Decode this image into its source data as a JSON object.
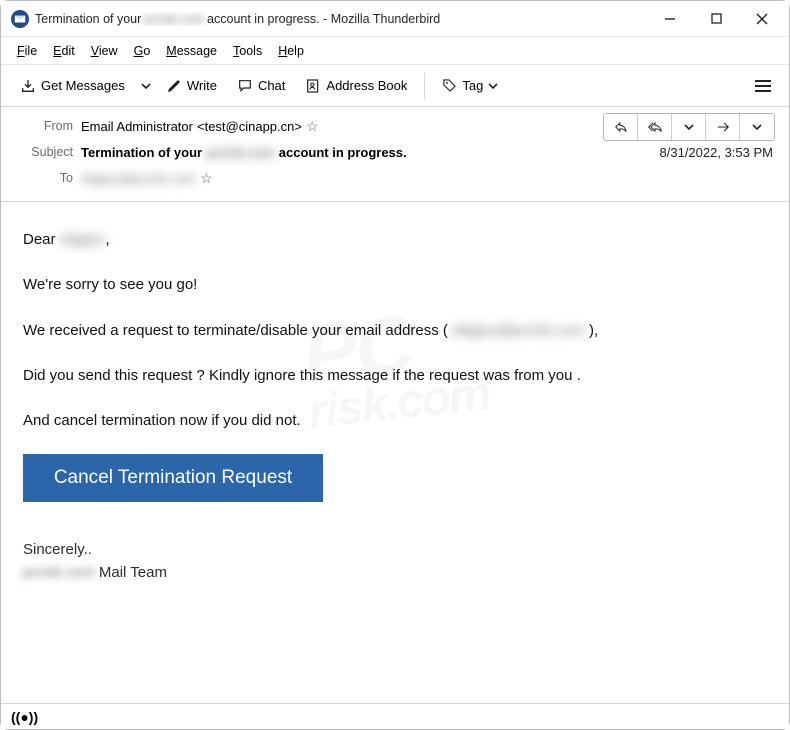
{
  "window": {
    "title_prefix": "Termination of your",
    "title_redacted": "pcrisk.com",
    "title_suffix": "account in progress. - Mozilla Thunderbird"
  },
  "menubar": {
    "file": "File",
    "edit": "Edit",
    "view": "View",
    "go": "Go",
    "message": "Message",
    "tools": "Tools",
    "help": "Help"
  },
  "toolbar": {
    "get_messages": "Get Messages",
    "write": "Write",
    "chat": "Chat",
    "address_book": "Address Book",
    "tag": "Tag"
  },
  "header": {
    "from_label": "From",
    "from_name": "Email Administrator",
    "from_addr": "<test@cinapp.cn>",
    "subject_label": "Subject",
    "subject_prefix": "Termination of your",
    "subject_redacted": "pcrisk.com",
    "subject_suffix": "account in progress.",
    "to_label": "To",
    "to_redacted": "eligijus@pcrisk.com",
    "date": "8/31/2022, 3:53 PM"
  },
  "body": {
    "greet_prefix": "Dear ",
    "greet_redacted": "eligijus",
    "greet_suffix": ",",
    "p1": "We're sorry to see you go!",
    "p2_prefix": "We received a request to terminate/disable your email address ( ",
    "p2_redacted": "eligijus@pcrisk.com",
    "p2_suffix": " ),",
    "p3": "Did you send this request ? Kindly ignore this message if the request was from you .",
    "p4": "And cancel termination now if you did not.",
    "cta": "Cancel Termination Request",
    "sign1": "Sincerely..",
    "sign2_redacted": "pcrisk.com",
    "sign2_suffix": " Mail Team"
  },
  "watermark": {
    "line1": "PC",
    "line2": "risk.com"
  }
}
